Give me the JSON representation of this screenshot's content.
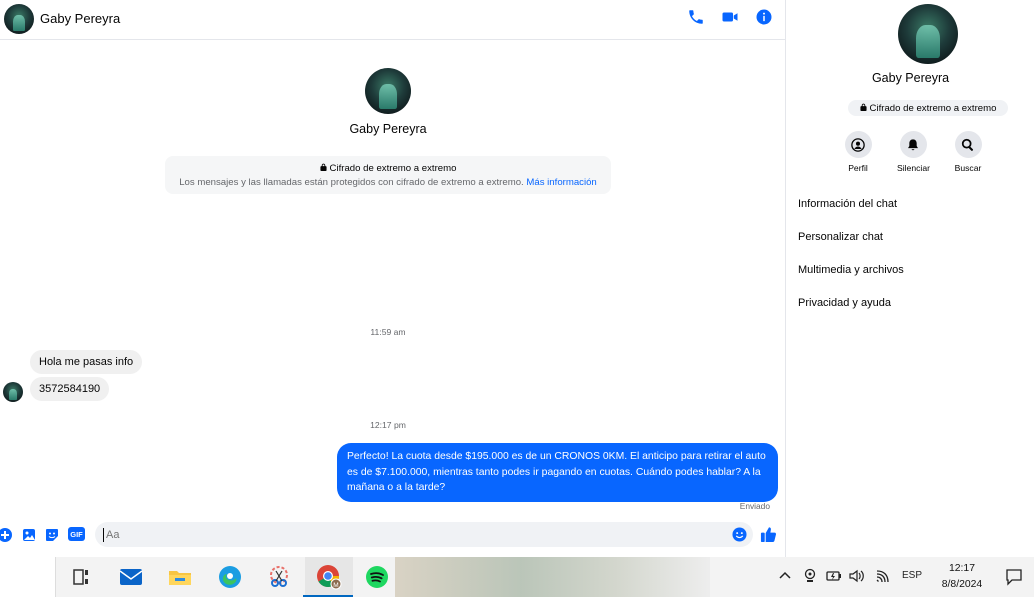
{
  "contact": {
    "name": "Gaby Pereyra"
  },
  "header": {
    "icons": [
      "phone-icon",
      "video-icon",
      "info-icon"
    ]
  },
  "encryption": {
    "title": "Cifrado de extremo a extremo",
    "description": "Los mensajes y las llamadas están protegidos con cifrado de extremo a extremo.",
    "link": "Más información"
  },
  "messages": {
    "time1": "11:59 am",
    "incoming1": "Hola me pasas info",
    "incoming2": "3572584190",
    "time2": "12:17 pm",
    "outgoing1": "Perfecto! La cuota desde $195.000 es de un CRONOS 0KM. El anticipo para retirar el auto es de $7.100.000, mientras tanto podes ir pagando en cuotas. Cuándo podes hablar? A la mañana o a la tarde?",
    "status": "Enviado"
  },
  "composer": {
    "placeholder": "Aa"
  },
  "sidebar": {
    "name": "Gaby Pereyra",
    "encryption": "Cifrado de extremo a extremo",
    "actions": {
      "profile": "Perfil",
      "mute": "Silenciar",
      "search": "Buscar"
    },
    "menu": [
      "Información del chat",
      "Personalizar chat",
      "Multimedia y archivos",
      "Privacidad y ayuda"
    ]
  },
  "taskbar": {
    "language": "ESP",
    "time": "12:17",
    "date": "8/8/2024"
  },
  "colors": {
    "accent": "#0866ff",
    "bubble_in": "#f0f0f0",
    "spotify": "#1ed760"
  }
}
